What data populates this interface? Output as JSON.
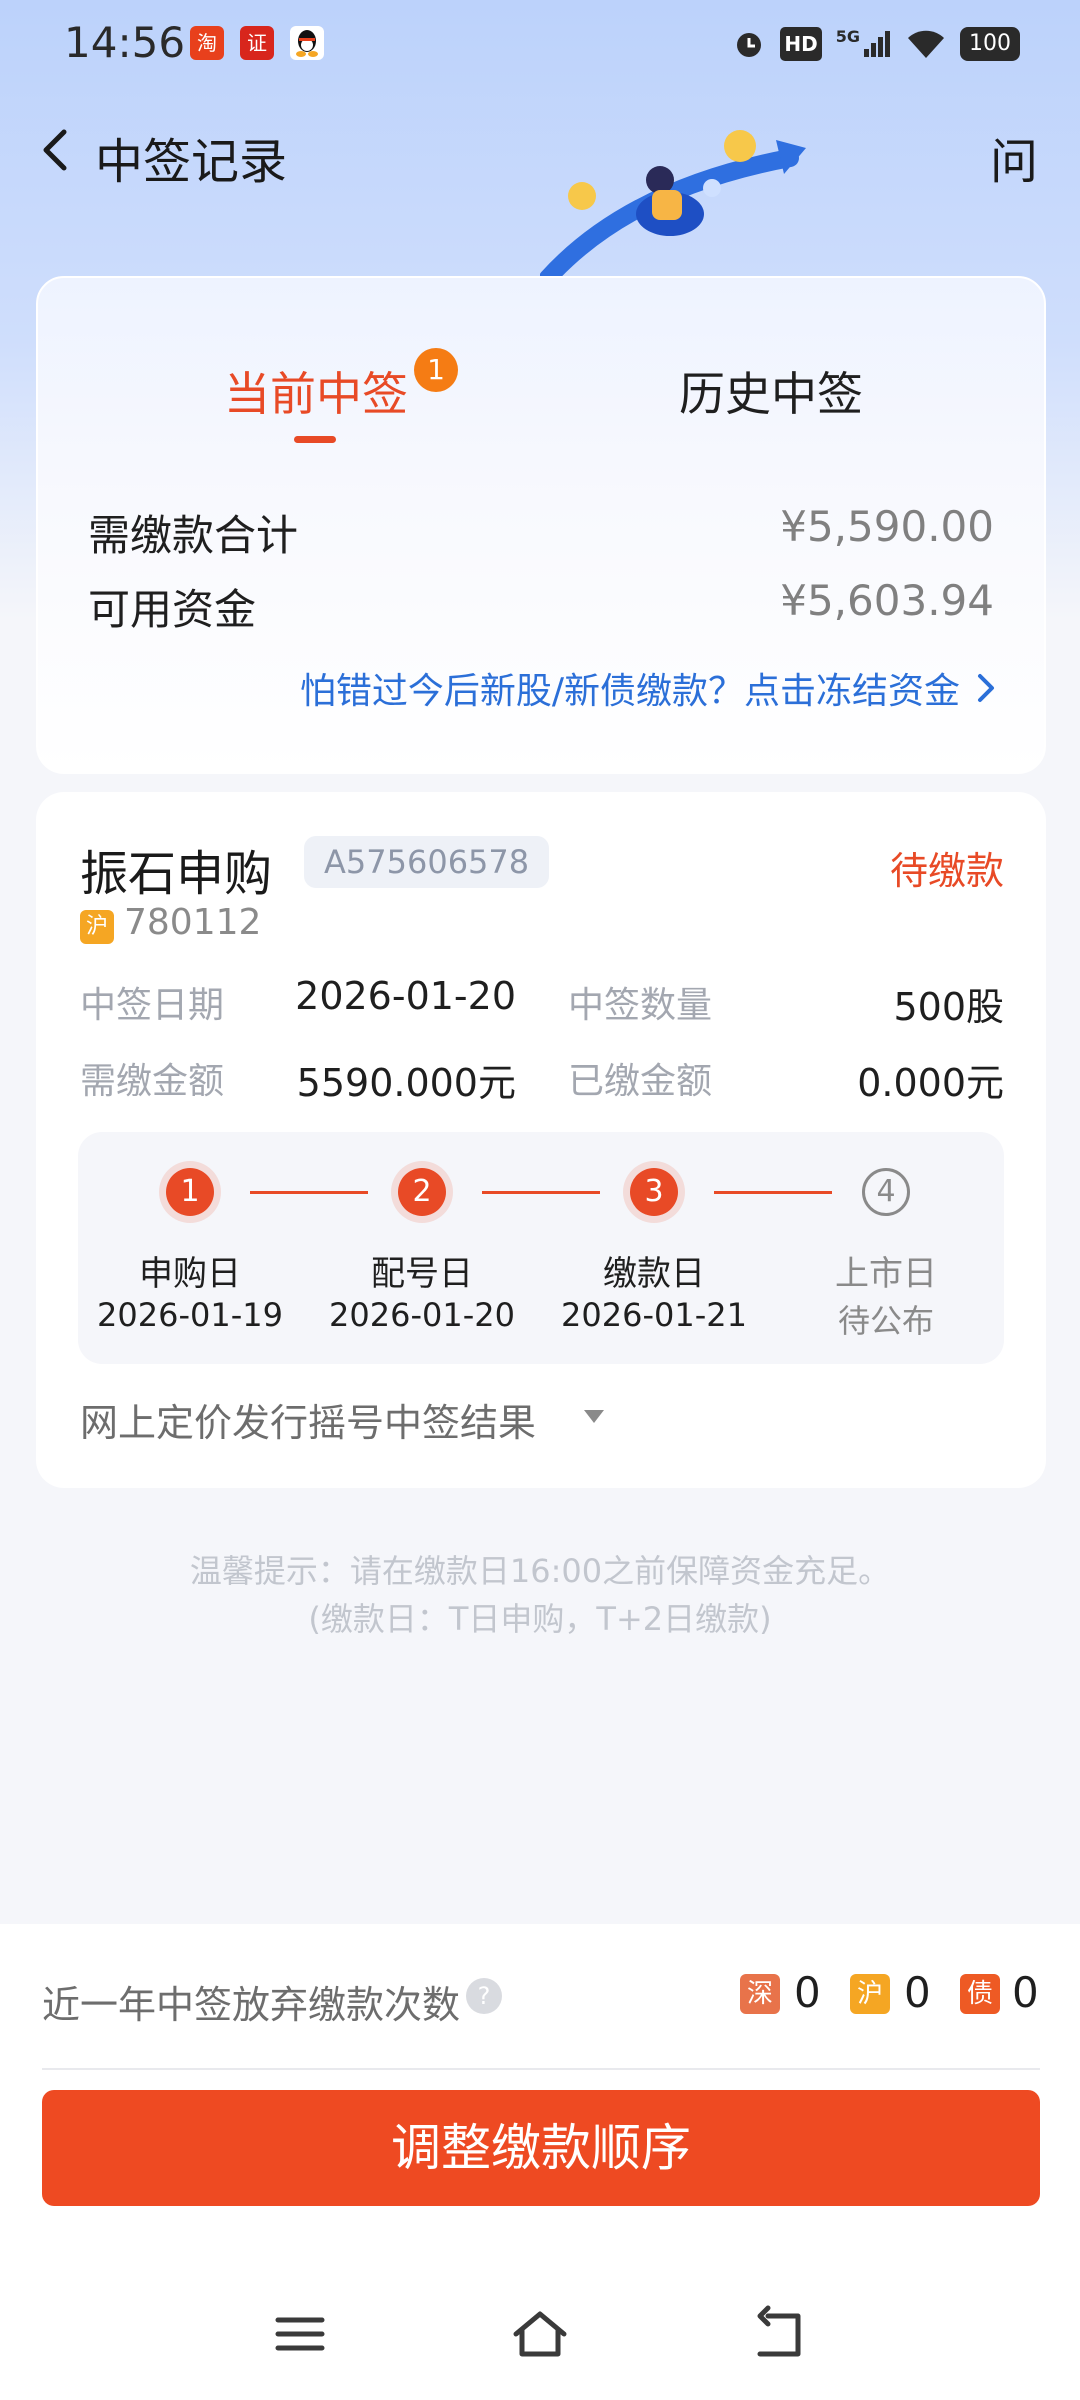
{
  "status_bar": {
    "time": "14:56",
    "apps": [
      {
        "name": "taobao-icon",
        "glyph": "淘",
        "color": "#e8401c"
      },
      {
        "name": "securities-app-icon",
        "glyph": "证",
        "color": "#d8261c"
      },
      {
        "name": "qq-icon",
        "glyph": "",
        "color": "#111111"
      }
    ],
    "net_label": "5G",
    "hd_label": "HD",
    "battery": "100"
  },
  "nav": {
    "title": "中签记录",
    "ask": "问"
  },
  "summary": {
    "tab_current": "当前中签",
    "tab_current_badge": "1",
    "tab_history": "历史中签",
    "rows": [
      {
        "label": "需缴款合计",
        "value": "¥5,590.00"
      },
      {
        "label": "可用资金",
        "value": "¥5,603.94"
      }
    ],
    "freeze_link": "怕错过今后新股/新债缴款？点击冻结资金"
  },
  "detail": {
    "stock_name": "振石申购",
    "order_id": "A575606578",
    "pay_status": "待缴款",
    "market_tag": "沪",
    "stock_code": "780112",
    "info": [
      {
        "label": "中签日期",
        "value": "2026-01-20"
      },
      {
        "label": "中签数量",
        "value": "500股"
      },
      {
        "label": "需缴金额",
        "value": "5590.000元"
      },
      {
        "label": "已缴金额",
        "value": "0.000元"
      }
    ],
    "steps": [
      {
        "num": "1",
        "name": "申购日",
        "date": "2026-01-19",
        "done": true
      },
      {
        "num": "2",
        "name": "配号日",
        "date": "2026-01-20",
        "done": true
      },
      {
        "num": "3",
        "name": "缴款日",
        "date": "2026-01-21",
        "done": true
      },
      {
        "num": "4",
        "name": "上市日",
        "date": "待公布",
        "done": false
      }
    ],
    "result_link": "网上定价发行摇号中签结果"
  },
  "tips": {
    "line1": "温馨提示：请在缴款日16:00之前保障资金充足。",
    "line2": "(缴款日：T日申购，T+2日缴款)"
  },
  "bottom": {
    "abandon_label": "近一年中签放弃缴款次数",
    "help": "?",
    "markets": [
      {
        "tag": "深",
        "count": "0",
        "color": "#e8734a"
      },
      {
        "tag": "沪",
        "count": "0",
        "color": "#f5a623"
      },
      {
        "tag": "债",
        "count": "0",
        "color": "#ee5a24"
      }
    ],
    "button": "调整缴款顺序"
  },
  "colors": {
    "accent": "#e84a26",
    "link": "#2b6fd8",
    "primary_button": "#ee4a22"
  }
}
